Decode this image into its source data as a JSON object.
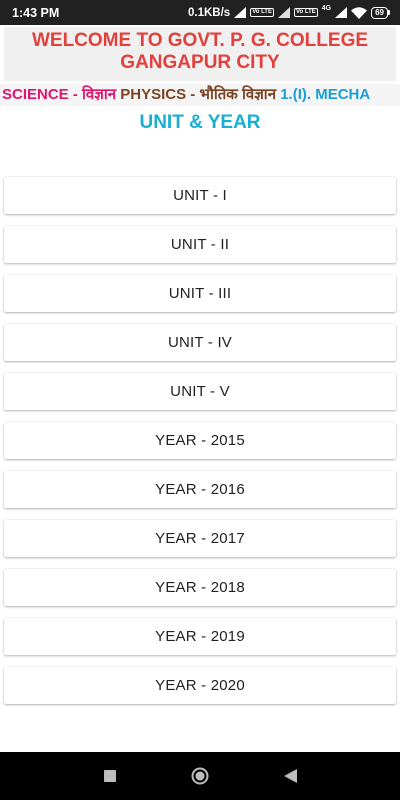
{
  "status_bar": {
    "time": "1:43 PM",
    "speed": "0.1KB/s",
    "volte1": "Vo LTE",
    "volte2": "Vo LTE",
    "network": "4G",
    "battery": "69"
  },
  "header": {
    "title_line1": "WELCOME TO GOVT. P. G. COLLEGE",
    "title_line2": "GANGAPUR CITY"
  },
  "marquee": {
    "part1": "SCIENCE - विज्ञान",
    "part2": "PHYSICS - भौतिक विज्ञान",
    "part3": "1.(I). MECHA"
  },
  "section_title": "UNIT & YEAR",
  "buttons": [
    "UNIT - I",
    "UNIT - II",
    "UNIT - III",
    "UNIT - IV",
    "UNIT - V",
    "YEAR - 2015",
    "YEAR - 2016",
    "YEAR - 2017",
    "YEAR - 2018",
    "YEAR - 2019",
    "YEAR - 2020"
  ],
  "colors": {
    "header_text": "#e2403c",
    "section_title": "#1aaed3",
    "marquee_pink": "#e0166e",
    "marquee_brown": "#7b4424",
    "marquee_blue": "#1a9ed8"
  },
  "nav_icons": [
    "recents-square-icon",
    "home-circle-icon",
    "back-triangle-icon"
  ]
}
